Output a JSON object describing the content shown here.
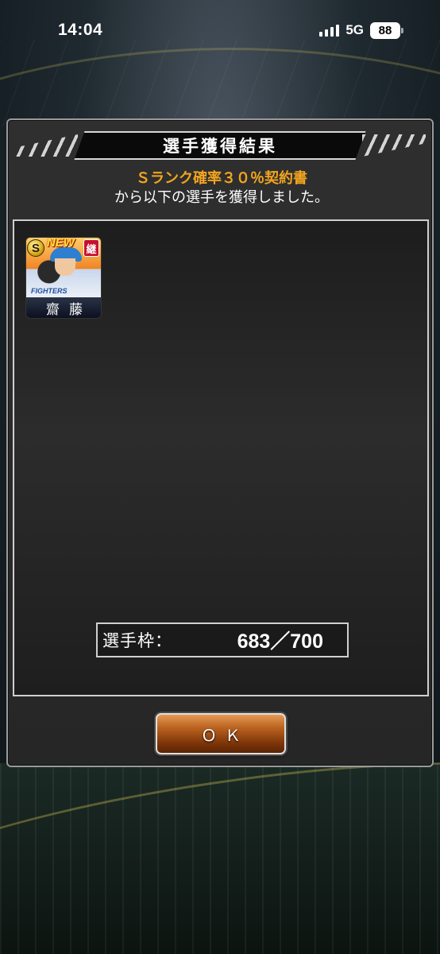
{
  "status_bar": {
    "time": "14:04",
    "network": "5G",
    "battery": "88"
  },
  "dialog": {
    "title": "選手獲得結果",
    "message_item": "Ｓランク確率３０％契約書",
    "message_line2": "から以下の選手を獲得しました。",
    "player_card": {
      "rank": "S",
      "new_label": "NEW",
      "inherit_label": "継",
      "team_text": "FIGHTERS",
      "name": "齋藤"
    },
    "capacity": {
      "label": "選手枠：",
      "value": "683／700"
    },
    "ok_label": "ＯＫ"
  },
  "colors": {
    "item_name": "#f2a51f",
    "ok_button": "#b9611f",
    "inherit_badge": "#c8102e"
  }
}
